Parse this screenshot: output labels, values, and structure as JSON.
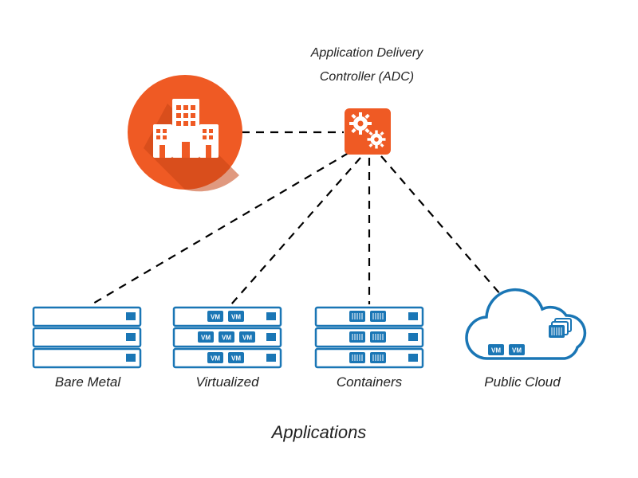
{
  "colors": {
    "orange": "#ef5a24",
    "orange_dark": "#c74616",
    "blue": "#1a76b5",
    "white": "#ffffff",
    "text": "#222222"
  },
  "adc": {
    "title_line1": "Application Delivery",
    "title_line2": "Controller (ADC)"
  },
  "nodes": {
    "bare_metal": {
      "label": "Bare Metal"
    },
    "virtualized": {
      "label": "Virtualized"
    },
    "containers": {
      "label": "Containers"
    },
    "public_cloud": {
      "label": "Public Cloud"
    }
  },
  "footer": {
    "label": "Applications"
  }
}
